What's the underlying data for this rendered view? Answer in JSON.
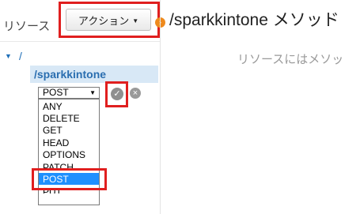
{
  "left_panel": {
    "title": "リソース",
    "actions_button": {
      "label": "アクション"
    }
  },
  "tree": {
    "root": "/",
    "resource": "/sparkkintone"
  },
  "method_select": {
    "value": "POST",
    "options": [
      "ANY",
      "DELETE",
      "GET",
      "HEAD",
      "OPTIONS",
      "PATCH",
      "POST",
      "PUT"
    ],
    "highlighted": "POST"
  },
  "main": {
    "title": "/sparkkintone メソッド",
    "hint": "リソースにはメソッ"
  },
  "colors": {
    "highlight_box": "#e01f1f",
    "selected_option": "#1e90ff",
    "resource_row": "#d8e8f6",
    "link_blue": "#2a6eb0",
    "orange_dot": "#ee8a1d"
  },
  "icons": {
    "check": "check-circle-icon",
    "cancel": "x-circle-icon",
    "caret": "caret-down-icon",
    "tree_toggle": "triangle-down-icon"
  }
}
